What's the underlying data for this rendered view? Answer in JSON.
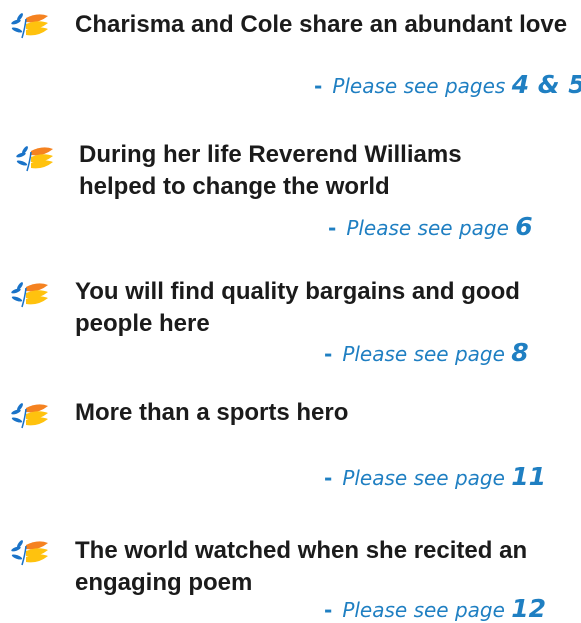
{
  "colors": {
    "headline": "#1b1b1b",
    "accent_blue": "#1f7fc2",
    "leaf_blue": "#1a73c8",
    "leaf_yellow": "#ffc20e",
    "leaf_orange": "#f58220"
  },
  "icon": "sprouting-leaves-logo",
  "items": [
    {
      "headline": "Charisma and Cole share an abundant love",
      "dash": "-",
      "ref_label": "Please see pages",
      "ref_pages": "4 & 5"
    },
    {
      "headline": "During her life Reverend Williams helped to change the world",
      "dash": "-",
      "ref_label": "Please see page",
      "ref_pages": "6"
    },
    {
      "headline": "You will find quality bargains and good people here",
      "dash": "-",
      "ref_label": "Please see page",
      "ref_pages": "8"
    },
    {
      "headline": "More than a sports hero",
      "dash": "-",
      "ref_label": "Please see page",
      "ref_pages": "11"
    },
    {
      "headline": "The world watched when she recited an engaging poem",
      "dash": "-",
      "ref_label": "Please see page",
      "ref_pages": "12"
    }
  ]
}
